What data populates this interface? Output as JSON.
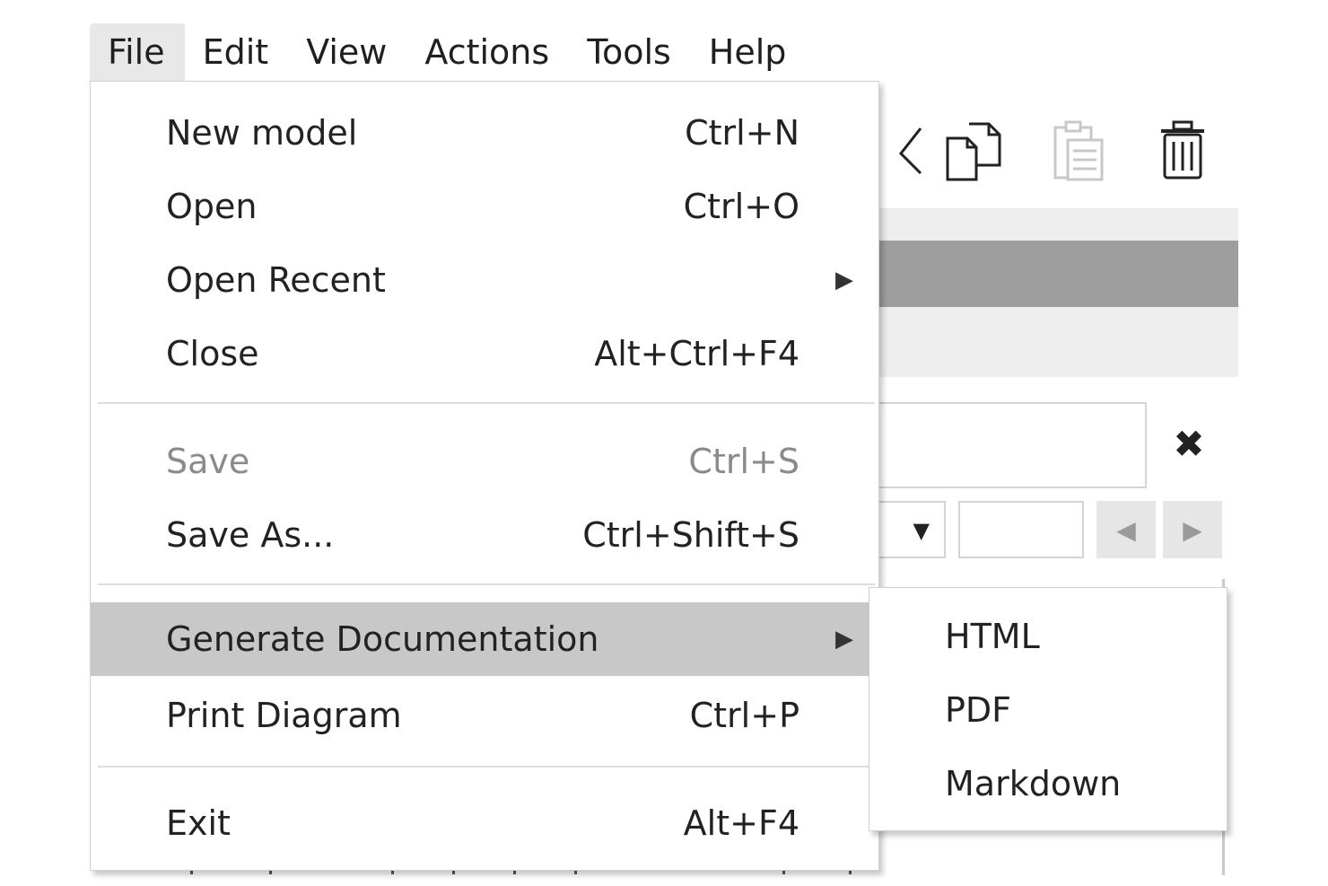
{
  "menubar": {
    "items": [
      {
        "label": "File"
      },
      {
        "label": "Edit"
      },
      {
        "label": "View"
      },
      {
        "label": "Actions"
      },
      {
        "label": "Tools"
      },
      {
        "label": "Help"
      }
    ],
    "active": "File"
  },
  "file_menu": {
    "items": [
      {
        "label": "New model",
        "shortcut": "Ctrl+N",
        "enabled": true
      },
      {
        "label": "Open",
        "shortcut": "Ctrl+O",
        "enabled": true
      },
      {
        "label": "Open Recent",
        "shortcut": "",
        "enabled": true,
        "submenu": true
      },
      {
        "label": "Close",
        "shortcut": "Alt+Ctrl+F4",
        "enabled": true
      },
      {
        "label": "Save",
        "shortcut": "Ctrl+S",
        "enabled": false
      },
      {
        "label": "Save As...",
        "shortcut": "Ctrl+Shift+S",
        "enabled": true
      },
      {
        "label": "Generate Documentation",
        "shortcut": "",
        "enabled": true,
        "submenu": true,
        "highlighted": true
      },
      {
        "label": "Print Diagram",
        "shortcut": "Ctrl+P",
        "enabled": true
      },
      {
        "label": "Exit",
        "shortcut": "Alt+F4",
        "enabled": true
      }
    ]
  },
  "generate_documentation_submenu": {
    "items": [
      {
        "label": "HTML"
      },
      {
        "label": "PDF"
      },
      {
        "label": "Markdown"
      }
    ]
  },
  "toolbar": {
    "icons": [
      "cut-icon",
      "copy-icon",
      "paste-icon",
      "delete-icon"
    ],
    "paste_enabled": false
  },
  "search": {
    "clear_symbol": "✖",
    "dropdown_arrow": "▼",
    "prev_symbol": "◀",
    "next_symbol": "▶"
  },
  "colors": {
    "highlight": "#c8c8c8",
    "active_menu": "#e8e8e8",
    "disabled_text": "#8a8a8a",
    "band_dark": "#9e9e9e"
  }
}
